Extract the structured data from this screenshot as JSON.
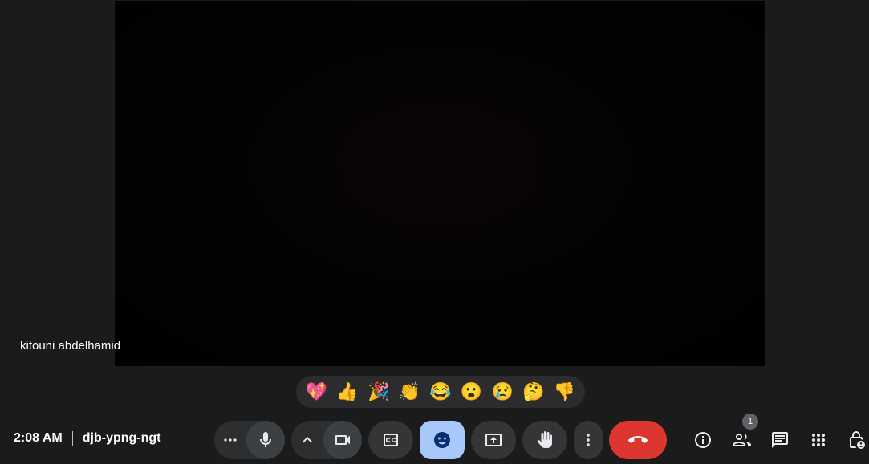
{
  "participant": {
    "name": "kitouni abdelhamid"
  },
  "reactions": [
    {
      "emoji": "💖",
      "name": "sparkling-heart-reaction"
    },
    {
      "emoji": "👍",
      "name": "thumbs-up-reaction"
    },
    {
      "emoji": "🎉",
      "name": "party-popper-reaction"
    },
    {
      "emoji": "👏",
      "name": "clapping-reaction"
    },
    {
      "emoji": "😂",
      "name": "laughing-reaction"
    },
    {
      "emoji": "😮",
      "name": "surprised-reaction"
    },
    {
      "emoji": "😢",
      "name": "crying-reaction"
    },
    {
      "emoji": "🤔",
      "name": "thinking-reaction"
    },
    {
      "emoji": "👎",
      "name": "thumbs-down-reaction"
    }
  ],
  "meeting": {
    "time": "2:08 AM",
    "code": "djb-ypng-ngt"
  },
  "participants_badge": "1",
  "colors": {
    "leave": "#dc362e",
    "emoji_active": "#a8c7fa",
    "control_bg": "#333537",
    "page_bg": "#1b1b1b"
  },
  "icons": {
    "mic": "mic-icon",
    "audio_options": "more-horiz-icon",
    "camera": "videocam-icon",
    "camera_options": "chevron-up-icon",
    "captions": "closed-caption-icon",
    "emoji": "smiley-icon",
    "present": "present-screen-icon",
    "raise_hand": "hand-icon",
    "more": "more-vert-icon",
    "leave": "call-end-icon",
    "info": "info-icon",
    "people": "people-icon",
    "chat": "chat-icon",
    "activities": "apps-grid-icon",
    "host_controls": "lock-person-icon"
  }
}
